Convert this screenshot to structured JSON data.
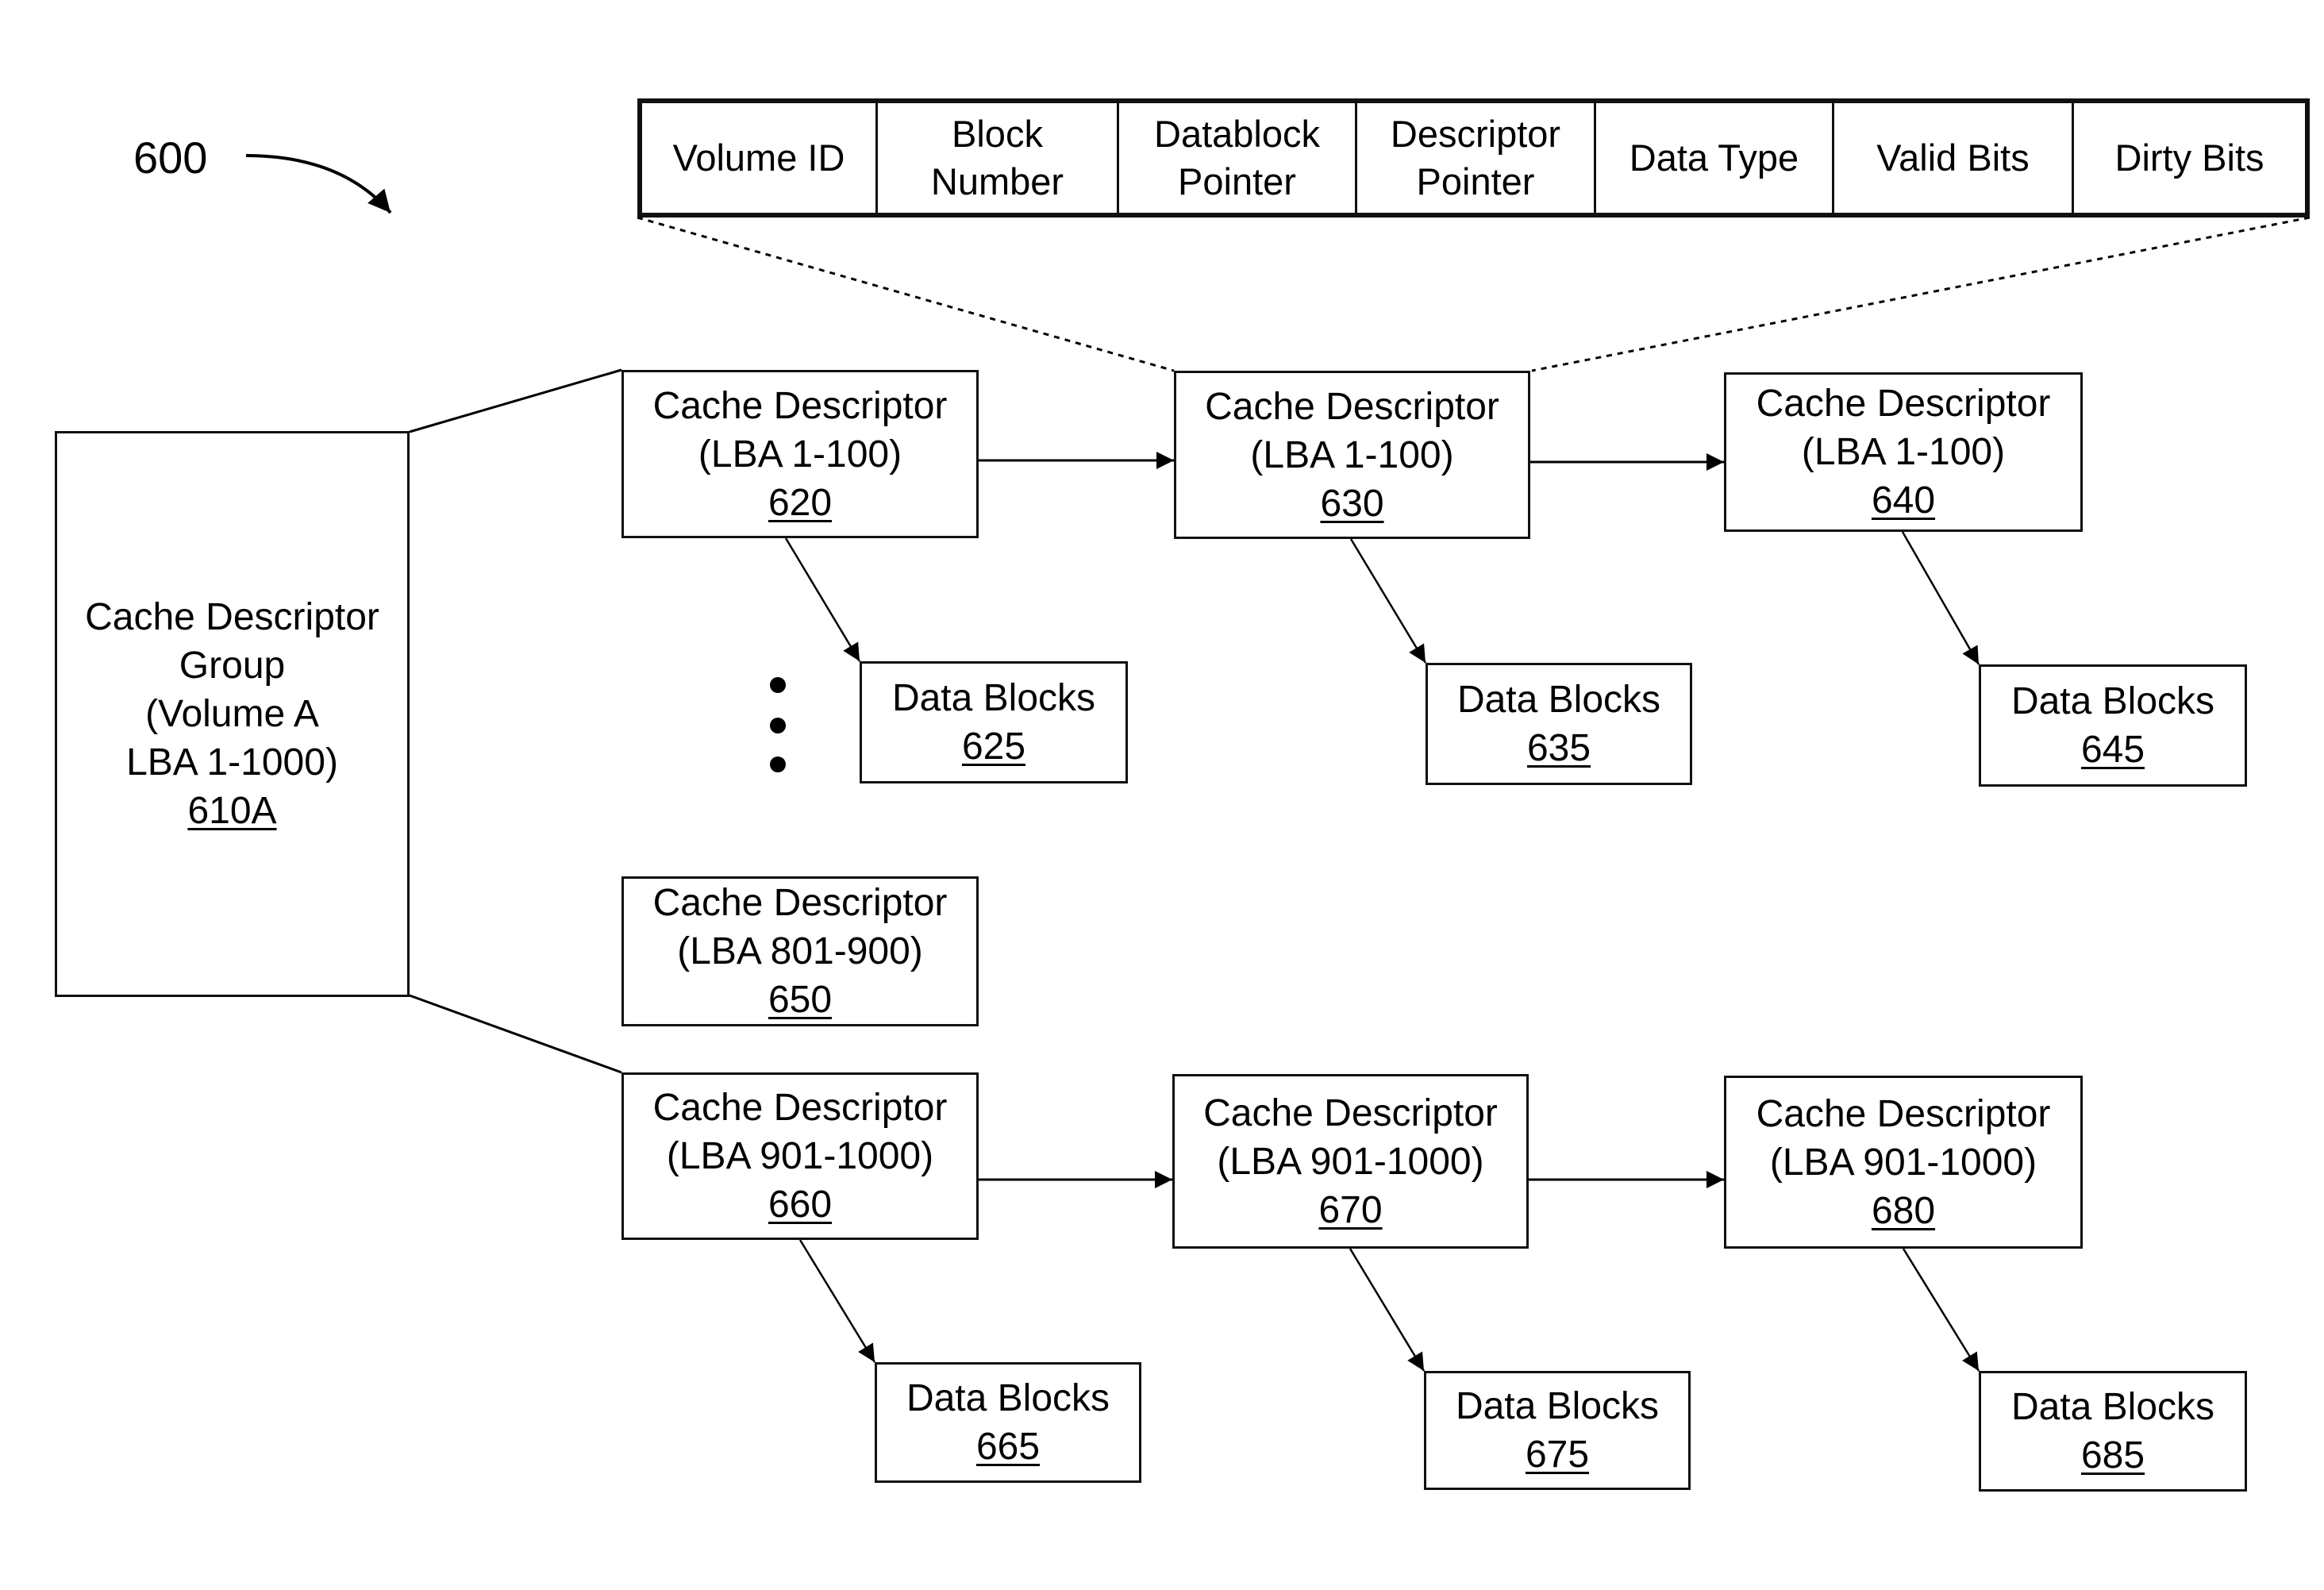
{
  "figure": {
    "label": "600"
  },
  "descriptor_fields": [
    {
      "label": "Volume ID"
    },
    {
      "label": "Block\nNumber"
    },
    {
      "label": "Datablock\nPointer"
    },
    {
      "label": "Descriptor\nPointer"
    },
    {
      "label": "Data Type"
    },
    {
      "label": "Valid Bits"
    },
    {
      "label": "Dirty Bits"
    }
  ],
  "group": {
    "lines": [
      "Cache Descriptor",
      "Group",
      "(Volume A",
      "LBA 1-1000)"
    ],
    "ref": "610A"
  },
  "descriptors": {
    "d620": {
      "title": "Cache Descriptor",
      "range": "(LBA 1-100)",
      "ref": "620"
    },
    "d630": {
      "title": "Cache Descriptor",
      "range": "(LBA 1-100)",
      "ref": "630"
    },
    "d640": {
      "title": "Cache Descriptor",
      "range": "(LBA 1-100)",
      "ref": "640"
    },
    "d650": {
      "title": "Cache Descriptor",
      "range": "(LBA 801-900)",
      "ref": "650"
    },
    "d660": {
      "title": "Cache Descriptor",
      "range": "(LBA 901-1000)",
      "ref": "660"
    },
    "d670": {
      "title": "Cache Descriptor",
      "range": "(LBA 901-1000)",
      "ref": "670"
    },
    "d680": {
      "title": "Cache Descriptor",
      "range": "(LBA 901-1000)",
      "ref": "680"
    }
  },
  "data_blocks": {
    "b625": {
      "title": "Data Blocks",
      "ref": "625"
    },
    "b635": {
      "title": "Data Blocks",
      "ref": "635"
    },
    "b645": {
      "title": "Data Blocks",
      "ref": "645"
    },
    "b665": {
      "title": "Data Blocks",
      "ref": "665"
    },
    "b675": {
      "title": "Data Blocks",
      "ref": "675"
    },
    "b685": {
      "title": "Data Blocks",
      "ref": "685"
    }
  },
  "ellipsis": "vertical-ellipsis"
}
